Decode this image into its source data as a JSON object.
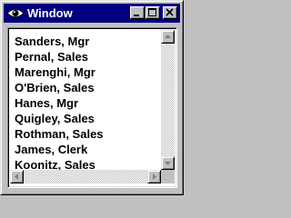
{
  "window": {
    "title": "Window",
    "title_icon": "eye-icon",
    "controls": [
      "minimize-icon",
      "maximize-icon",
      "close-icon"
    ]
  },
  "list": {
    "items": [
      "Sanders, Mgr",
      "Pernal, Sales",
      "Marenghi, Mgr",
      "O'Brien, Sales",
      "Hanes, Mgr",
      "Quigley, Sales",
      "Rothman, Sales",
      "James, Clerk",
      "Koonitz, Sales"
    ]
  },
  "scrollbars": {
    "vertical_icons": [
      "up-arrow-icon",
      "down-arrow-icon"
    ],
    "horizontal_icons": [
      "left-arrow-icon",
      "right-arrow-icon"
    ]
  },
  "colors": {
    "titlebar": "#000080",
    "face": "#c0c0c0",
    "list_background": "#ffffff"
  }
}
